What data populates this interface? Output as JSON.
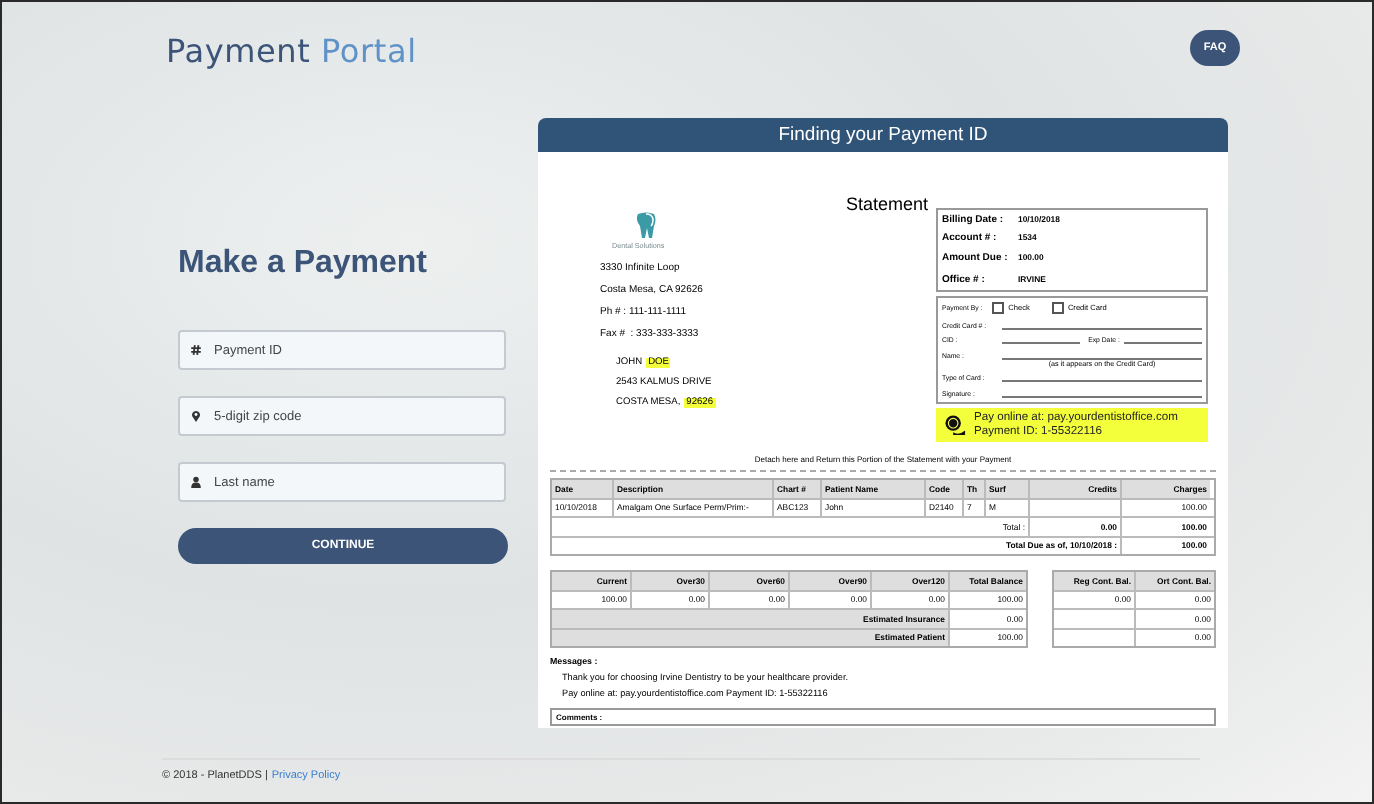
{
  "logo": {
    "word_1": "Payment",
    "word_2": "Portal"
  },
  "faq_button": "FAQ",
  "form": {
    "title": "Make a Payment",
    "fields": [
      {
        "kind": "hash",
        "placeholder": "Payment ID"
      },
      {
        "kind": "pin",
        "placeholder": "5-digit zip code"
      },
      {
        "kind": "person",
        "placeholder": "Last name"
      }
    ],
    "submit": "CONTINUE"
  },
  "panel": {
    "title": "Finding your Payment ID",
    "statement": {
      "title": "Statement",
      "practice": {
        "name": "Dental Solutions",
        "lines": [
          "3330 Infinite Loop",
          "Costa Mesa, CA 92626",
          "Ph # : 111-111-1111",
          "Fax #  : 333-333-3333"
        ]
      },
      "patient": [
        [
          {
            "text": "JOHN",
            "highlighted": false
          },
          {
            "text": "DOE",
            "highlighted": true
          }
        ],
        [
          {
            "text": "2543 KALMUS DRIVE",
            "highlighted": false
          }
        ],
        [
          {
            "text": "COSTA MESA,",
            "highlighted": false
          },
          {
            "text": "92626",
            "highlighted": true
          }
        ]
      ],
      "summary": [
        {
          "label": "Billing Date :",
          "value": "10/10/2018"
        },
        {
          "label": "Account # :",
          "value": "1534"
        },
        {
          "label": "Amount Due :",
          "value": "100.00"
        },
        {
          "label": "Office # :",
          "value": "IRVINE"
        }
      ],
      "payment_by": {
        "label": "Payment By :",
        "options": [
          {
            "label": "Check",
            "checked": false
          },
          {
            "label": "Credit Card",
            "checked": false
          }
        ]
      },
      "payment_fields": [
        {
          "label": "Credit Card # :"
        },
        {
          "label": "CID :",
          "second_label": "Exp Date :"
        },
        {
          "label": "Name :",
          "note": "(as it appears on the Credit Card)"
        },
        {
          "label": "Type of Card :"
        },
        {
          "label": "Signature :"
        }
      ],
      "online": [
        "Pay online at: pay.yourdentistoffice.com",
        "Payment ID: 1-55322116"
      ],
      "detach_note": "Detach here and Return this Portion of the Statement with your Payment",
      "charges": {
        "columns": [
          "Date",
          "Description",
          "Chart #",
          "Patient Name",
          "Code",
          "Th",
          "Surf",
          "Credits",
          "Charges"
        ],
        "rows": [
          [
            "10/10/2018",
            "Amalgam One Surface Perm/Prim:-",
            "ABC123",
            "John",
            "D2140",
            "7",
            "M",
            "",
            "100.00"
          ]
        ],
        "total_label": "Total :",
        "total_credits": "0.00",
        "total_charges": "100.00",
        "due_label": "Total Due as of,  10/10/2018  :",
        "due_value": "100.00"
      },
      "aging": {
        "columns": [
          "Current",
          "Over30",
          "Over60",
          "Over90",
          "Over120",
          "Total Balance"
        ],
        "values": [
          "100.00",
          "0.00",
          "0.00",
          "0.00",
          "0.00",
          "100.00"
        ],
        "estimates": [
          {
            "label": "Estimated Insurance",
            "value": "0.00"
          },
          {
            "label": "Estimated Patient",
            "value": "100.00"
          }
        ]
      },
      "contract": {
        "columns": [
          "Reg Cont. Bal.",
          "Ort Cont. Bal."
        ],
        "rows": [
          {
            "reg": "0.00",
            "ort": "0.00"
          },
          {
            "ort": "0.00"
          },
          {
            "ort": "0.00"
          }
        ]
      },
      "messages": {
        "title": "Messages :",
        "lines": [
          "Thank you for choosing Irvine Dentistry to be your healthcare provider.",
          "Pay online at: pay.yourdentistoffice.com Payment ID: 1-55322116"
        ]
      },
      "comments_label": "Comments :"
    }
  },
  "footer": {
    "copyright": "© 2018 - PlanetDDS |",
    "link": "Privacy Policy"
  }
}
